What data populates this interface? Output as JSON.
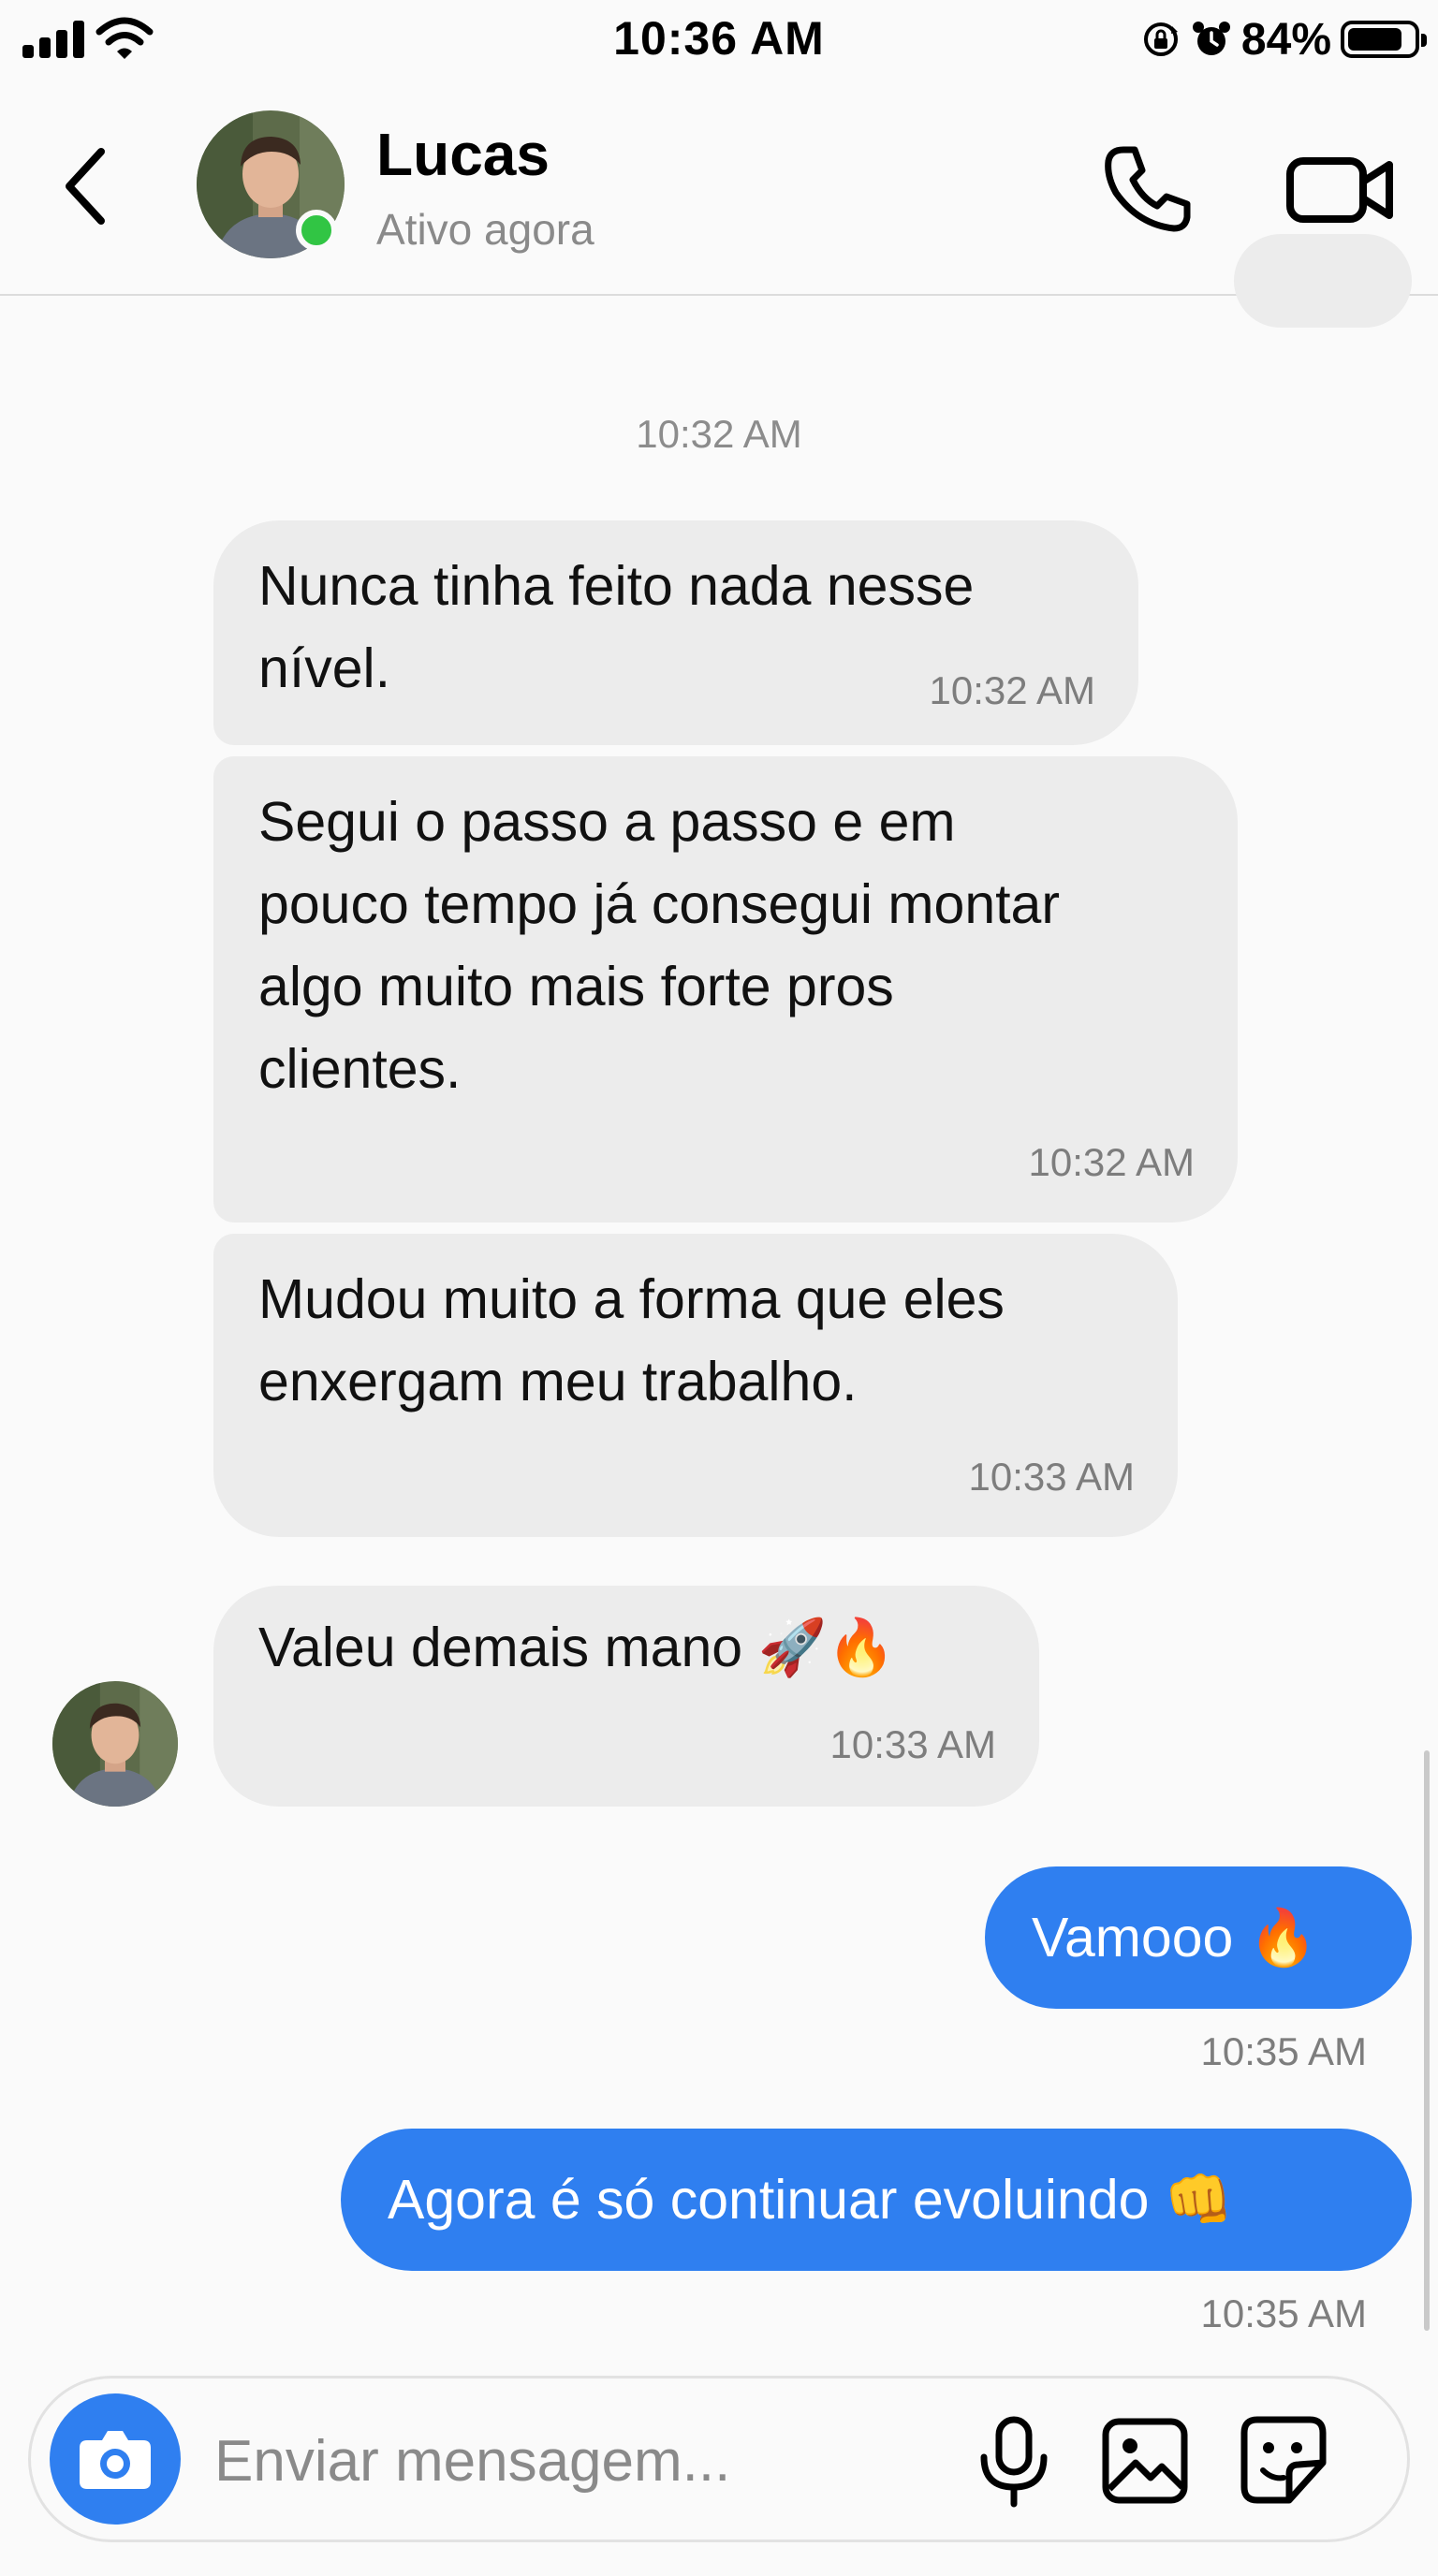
{
  "status_bar": {
    "time": "10:36 AM",
    "battery_percent": "84%",
    "battery_level": 0.84
  },
  "header": {
    "name": "Lucas",
    "status": "Ativo agora"
  },
  "messages": {
    "group_time": "10:32 AM",
    "incoming": [
      {
        "text": "Nunca tinha feito nada nesse\nnível.",
        "time": "10:32 AM"
      },
      {
        "text": "Segui o passo a passo e em\npouco tempo já consegui montar\nalgo muito mais forte pros\nclientes.",
        "time": "10:32 AM"
      },
      {
        "text": "Mudou muito a forma que eles\nenxergam meu trabalho.",
        "time": "10:33 AM"
      },
      {
        "text": "Valeu demais mano 🚀🔥",
        "time": "10:33 AM"
      }
    ],
    "outgoing": [
      {
        "text": "Vamooo 🔥",
        "time": "10:35 AM"
      },
      {
        "text": "Agora é só continuar evoluindo 👊",
        "time": "10:35 AM"
      }
    ]
  },
  "composer": {
    "placeholder": "Enviar mensagem..."
  },
  "icons": {
    "back": "chevron-left-icon",
    "call": "phone-icon",
    "video": "video-camera-icon",
    "camera": "camera-icon",
    "mic": "microphone-icon",
    "gallery": "image-icon",
    "sticker": "sticker-icon"
  },
  "colors": {
    "accent": "#2f7ff0",
    "online": "#31c544",
    "incoming_bubble": "#ececec"
  }
}
